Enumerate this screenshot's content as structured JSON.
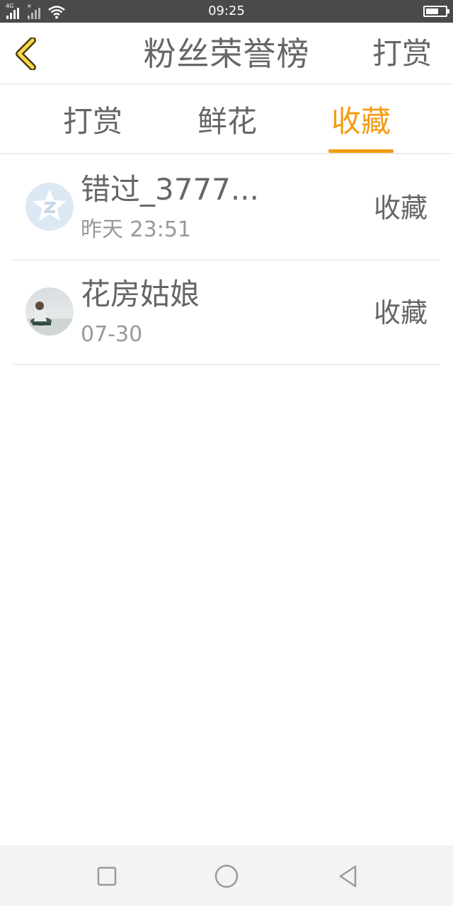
{
  "status_bar": {
    "network_tag": "4G",
    "time": "09:25"
  },
  "header": {
    "title": "粉丝荣誉榜",
    "action_label": "打赏",
    "back_icon": "chevron-left-icon"
  },
  "tabs": [
    {
      "label": "打赏",
      "active": false
    },
    {
      "label": "鲜花",
      "active": false
    },
    {
      "label": "收藏",
      "active": true
    }
  ],
  "list": {
    "items": [
      {
        "name": "错过_3777...",
        "time": "昨天 23:51",
        "action": "收藏"
      },
      {
        "name": "花房姑娘",
        "time": "07-30",
        "action": "收藏"
      }
    ]
  },
  "colors": {
    "accent": "#f39c12",
    "text": "#666666",
    "subtext": "#999999",
    "status_bar_bg": "#4a4a4a"
  }
}
